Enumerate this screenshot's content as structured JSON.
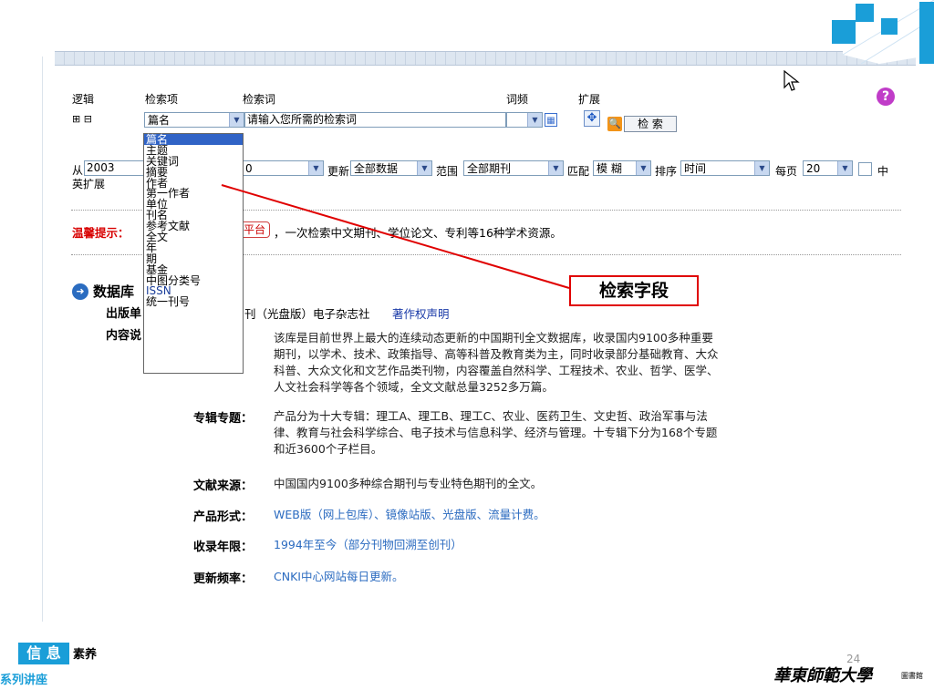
{
  "header": {
    "logic": "逻辑",
    "field": "检索项",
    "term": "检索词",
    "freq": "词频",
    "ext": "扩展",
    "help_icon": "question-icon"
  },
  "row1": {
    "logic_controls": "⊞ ⊟",
    "field_value": "篇名",
    "term_placeholder": "请输入您所需的检索词",
    "freq_value": "",
    "search_button": "检 索"
  },
  "dropdown": {
    "items": [
      "篇名",
      "主题",
      "关键词",
      "摘要",
      "作者",
      "第一作者",
      "单位",
      "刊名",
      "参考文献",
      "全文",
      "年",
      "期",
      "基金",
      "中图分类号",
      "ISSN",
      "统一刊号"
    ]
  },
  "row2": {
    "from": "从",
    "from_year": "2003",
    "to_year_suffix": "0",
    "update": "更新",
    "update_value": "全部数据",
    "scope": "范围",
    "scope_value": "全部期刊",
    "match": "匹配",
    "match_value": "模 糊",
    "sort": "排序",
    "sort_value": "时间",
    "per_page": "每页",
    "per_page_value": "20",
    "last": "中",
    "ext_label": "英扩展"
  },
  "hint": {
    "label": "温馨提示：",
    "link_tail": "平台",
    "text": "，一次检索中文期刊、学位论文、专利等16种学术资源。"
  },
  "callout": "检索字段",
  "db": {
    "title_prefix": "数据库",
    "publisher_label": "出版单",
    "publisher_text": "刊（光盘版）电子杂志社",
    "copyright": "著作权声明",
    "content_label": "内容说"
  },
  "desc": {
    "intro": "该库是目前世界上最大的连续动态更新的中国期刊全文数据库，收录国内9100多种重要期刊，以学术、技术、政策指导、高等科普及教育类为主，同时收录部分基础教育、大众科普、大众文化和文艺作品类刊物，内容覆盖自然科学、工程技术、农业、哲学、医学、人文社会科学等各个领域，全文文献总量3252多万篇。",
    "intro_l1": "该库是目前世界上最大的连续动态更新的中国期刊全文数据库，收录国内9100多种重要",
    "intro_l2": "期刊，以学术、技术、政策指导、高等科普及教育类为主，同时收录部分基础教育、大众",
    "intro_l3": "科普、大众文化和文艺作品类刊物，内容覆盖自然科学、工程技术、农业、哲学、医学、",
    "intro_l4": "人文社会科学等各个领域，全文文献总量3252多万篇。",
    "topics_label": "专辑专题：",
    "topics_l1": "产品分为十大专辑：理工A、理工B、理工C、农业、医药卫生、文史哲、政治军事与法",
    "topics_l2": "律、教育与社会科学综合、电子技术与信息科学、经济与管理。十专辑下分为168个专题",
    "topics_l3": "和近3600个子栏目。",
    "source_label": "文献来源：",
    "source": "中国国内9100多种综合期刊与专业特色期刊的全文。",
    "form_label": "产品形式：",
    "form": "WEB版（网上包库）、镜像站版、光盘版、流量计费。",
    "years_label": "收录年限：",
    "years": "1994年至今（部分刊物回溯至创刊）",
    "update_label": "更新频率：",
    "update": "CNKI中心网站每日更新。"
  },
  "footer": {
    "badge": "信 息",
    "badge_tail": "素养",
    "series": "系列讲座",
    "page": "24",
    "university": "華東師範大學",
    "lib": "圖書館"
  }
}
